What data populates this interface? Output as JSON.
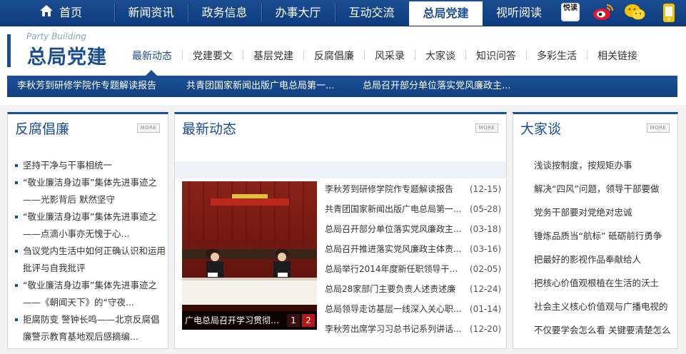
{
  "nav": {
    "home": "首页",
    "items": [
      "新闻资讯",
      "政务信息",
      "办事大厅",
      "互动交流",
      "总局党建",
      "视听阅读"
    ],
    "active_index": 4,
    "social_icons": [
      "yuedu-icon",
      "weibo-icon",
      "wechat-icon",
      "mobile-icon"
    ],
    "yuedu_label": "悦读"
  },
  "brand": {
    "en": "Party Building",
    "cn": "总局党建"
  },
  "subnav": {
    "items": [
      "最新动态",
      "党建要文",
      "基层党建",
      "反腐倡廉",
      "风采录",
      "大家谈",
      "知识问答",
      "多彩生活",
      "相关链接"
    ],
    "active_index": 0
  },
  "ticker": [
    "李秋芳到研修学院作专题解读报告",
    "共青团国家新闻出版广电总局第一...",
    "总局召开部分单位落实党风廉政主..."
  ],
  "more_label": "MORE",
  "left_panel": {
    "title": "反腐倡廉",
    "items": [
      "坚持干净与干事相统一",
      "“敬业廉洁身边事”集体先进事迹之——光影背后 默然坚守",
      "“敬业廉洁身边事”集体先进事迹之——点滴小事亦无愧于心...",
      "刍议党内生活中如何正确认识和运用批评与自我批评",
      "“敬业廉洁身边事”集体先进事迹之——《朝闻天下》的“守夜...",
      "拒腐防变 警钟长鸣——北京反腐倡廉警示教育基地观后感摘编..."
    ]
  },
  "middle_panel": {
    "title": "最新动态",
    "photo_caption": "广电总局召开学习贯彻十...",
    "pager": [
      "1",
      "2"
    ],
    "news": [
      {
        "title": "李秋芳到研修学院作专题解读报告",
        "date": "(12-15)"
      },
      {
        "title": "共青团国家新闻出版广电总局第一...",
        "date": "(05-28)"
      },
      {
        "title": "总局召开部分单位落实党风廉政主...",
        "date": "(03-18)"
      },
      {
        "title": "总局召开推进落实党风廉政主体责...",
        "date": "(03-16)"
      },
      {
        "title": "总局举行2014年度新任职领导干部...",
        "date": "(02-05)"
      },
      {
        "title": "总局28家部门主要负责人述责述廉",
        "date": "(12-24)"
      },
      {
        "title": "总局领导走访基层一线深入关心职...",
        "date": "(01-14)"
      },
      {
        "title": "李秋芳出席学习习总书记系列讲话...",
        "date": "(12-20)"
      }
    ]
  },
  "right_panel": {
    "title": "大家谈",
    "items": [
      "浅谈按制度，按规矩办事",
      "解决“四风”问题，领导干部要做",
      "党务干部要对党绝对忠诚",
      "锤炼品质当“航标” 砥砺前行勇争",
      "把最好的影视作品奉献给人",
      "把核心价值观根植在生活的沃土",
      "社会主义核心价值观与广播电视的",
      "不仅要学会怎么看 关键要清楚怎么"
    ]
  }
}
